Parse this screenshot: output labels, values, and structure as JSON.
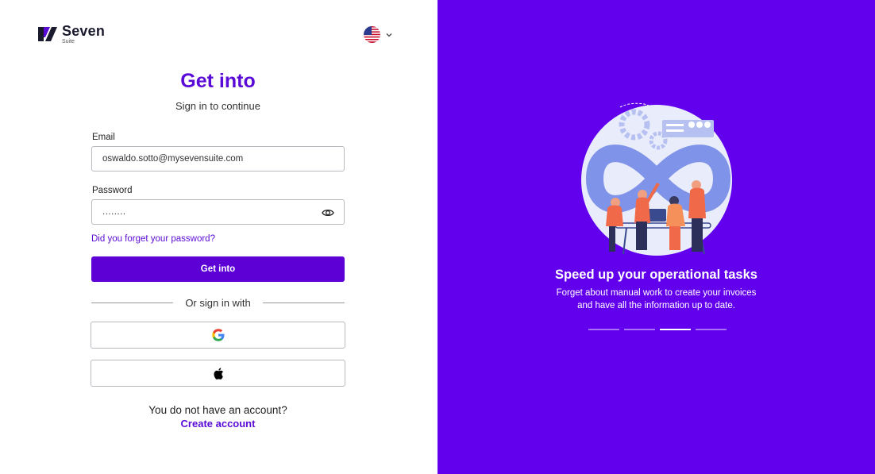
{
  "brand": {
    "name": "Seven",
    "sub": "Suite"
  },
  "language": {
    "flag_icon": "us-flag-icon"
  },
  "login": {
    "title": "Get into",
    "subtitle": "Sign in to continue",
    "email_label": "Email",
    "email_value": "oswaldo.sotto@mysevensuite.com",
    "password_label": "Password",
    "password_value": "........",
    "forgot_link": "Did you forget your password?",
    "submit_label": "Get into",
    "divider_text": "Or sign in with",
    "no_account_text": "You do not have an account?",
    "create_account_link": "Create account"
  },
  "promo": {
    "title": "Speed up your operational tasks",
    "line1": "Forget about manual work to create your invoices",
    "line2": "and have all the information up to date.",
    "carousel_count": 4,
    "carousel_active_index": 2
  },
  "colors": {
    "accent": "#5a0ad6",
    "panel": "#6200ee"
  }
}
